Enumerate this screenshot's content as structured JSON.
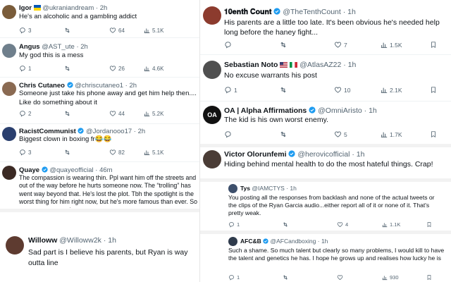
{
  "left": [
    {
      "name": "Igor",
      "flag": "ua",
      "handle": "@ukraniandream",
      "time": "2h",
      "text": "He's an alcoholic and a gambling addict",
      "replies": "3",
      "likes": "64",
      "views": "5.1K",
      "avatar_color": "#7a5c3a"
    },
    {
      "name": "Angus",
      "handle": "@AST_ute",
      "time": "2h",
      "text": "My god this is a mess",
      "replies": "1",
      "likes": "26",
      "views": "4.6K",
      "avatar_color": "#6f7f8c"
    },
    {
      "name": "Chris Cutaneo",
      "verified": true,
      "handle": "@chriscutaneo1",
      "time": "2h",
      "text": "Someone just take his phone away and get him help then.... Like do something about it",
      "replies": "2",
      "likes": "44",
      "views": "5.2K",
      "avatar_color": "#8a6a52"
    },
    {
      "name": "RacistCommunist",
      "verified": true,
      "handle": "@Jordanooo17",
      "time": "2h",
      "text": "Biggest clown in boxing fr😂😂",
      "replies": "3",
      "likes": "82",
      "views": "5.1K",
      "avatar_color": "#2a3f6e"
    },
    {
      "name": "Quaye",
      "verified": true,
      "handle": "@quayeofficial",
      "time": "46m",
      "text": "The compassion is wearing thin. Ppl want him off the streets and out of the way before he hurts someone now. The “trolling” has went way beyond that. He's lost the plot. Tbh the spotlight is the worst thing for him right now, but he's more famous than ever. So many yes men smh",
      "avatar_color": "#3b2a24"
    },
    {
      "name": "Willoww",
      "handle": "@Willoww2k",
      "time": "1h",
      "text": "Sad part is I believe his parents, but Ryan is way outta line",
      "avatar_color": "#5e3b30"
    }
  ],
  "right": [
    {
      "name": "𝟏𝟎𝐞𝐧𝐭𝐡 𝐂𝐨𝐮𝐧𝐭",
      "verified": true,
      "handle": "@TheTenthCount",
      "time": "1h",
      "text": "His parents are a little too late. It's been obvious he's needed help long before the haney fight...",
      "replies": "",
      "likes": "7",
      "views": "1.5K",
      "avatar_color": "#8c3b2e"
    },
    {
      "name": "Sebastian Noto",
      "flags": [
        "us",
        "it"
      ],
      "handle": "@AtlasAZ22",
      "time": "1h",
      "text": "No excuse warrants his post",
      "replies": "1",
      "likes": "10",
      "views": "2.1K",
      "avatar_color": "#4f4f4f"
    },
    {
      "name": "OA | Alpha Affirmations",
      "verified": true,
      "handle": "@OmniAristo",
      "time": "1h",
      "text": "The kid is his own worst enemy.",
      "replies": "",
      "likes": "5",
      "views": "1.7K",
      "avatar_color": "#111111",
      "avatar_text": "OA"
    },
    {
      "name": "Victor Olorunfemi",
      "verified": true,
      "handle": "@herovicofficial",
      "time": "1h",
      "text": "Hiding behind mental health to do the most hateful things. Crap!",
      "avatar_color": "#4a3c36"
    },
    {
      "name": "Tys",
      "handle": "@IAMCTYS",
      "time": "1h",
      "text": "You posting all the responses from backlash and none of the actual tweets or the clips of the Ryan Garcia audio...either report all of it or none of it. That's pretty weak.",
      "replies": "1",
      "likes": "4",
      "views": "1.1K",
      "avatar_color": "#3d4f6b"
    },
    {
      "name": "AFC&B",
      "verified": true,
      "handle": "@AFCandboxing",
      "time": "1h",
      "text": "Such a shame. So much talent but clearly so many problems, I would kill to have the talent and genetics he has. I hope he grows up and realises how lucky he is",
      "replies": "1",
      "likes": "",
      "views": "930",
      "avatar_color": "#2f3b4c"
    }
  ]
}
